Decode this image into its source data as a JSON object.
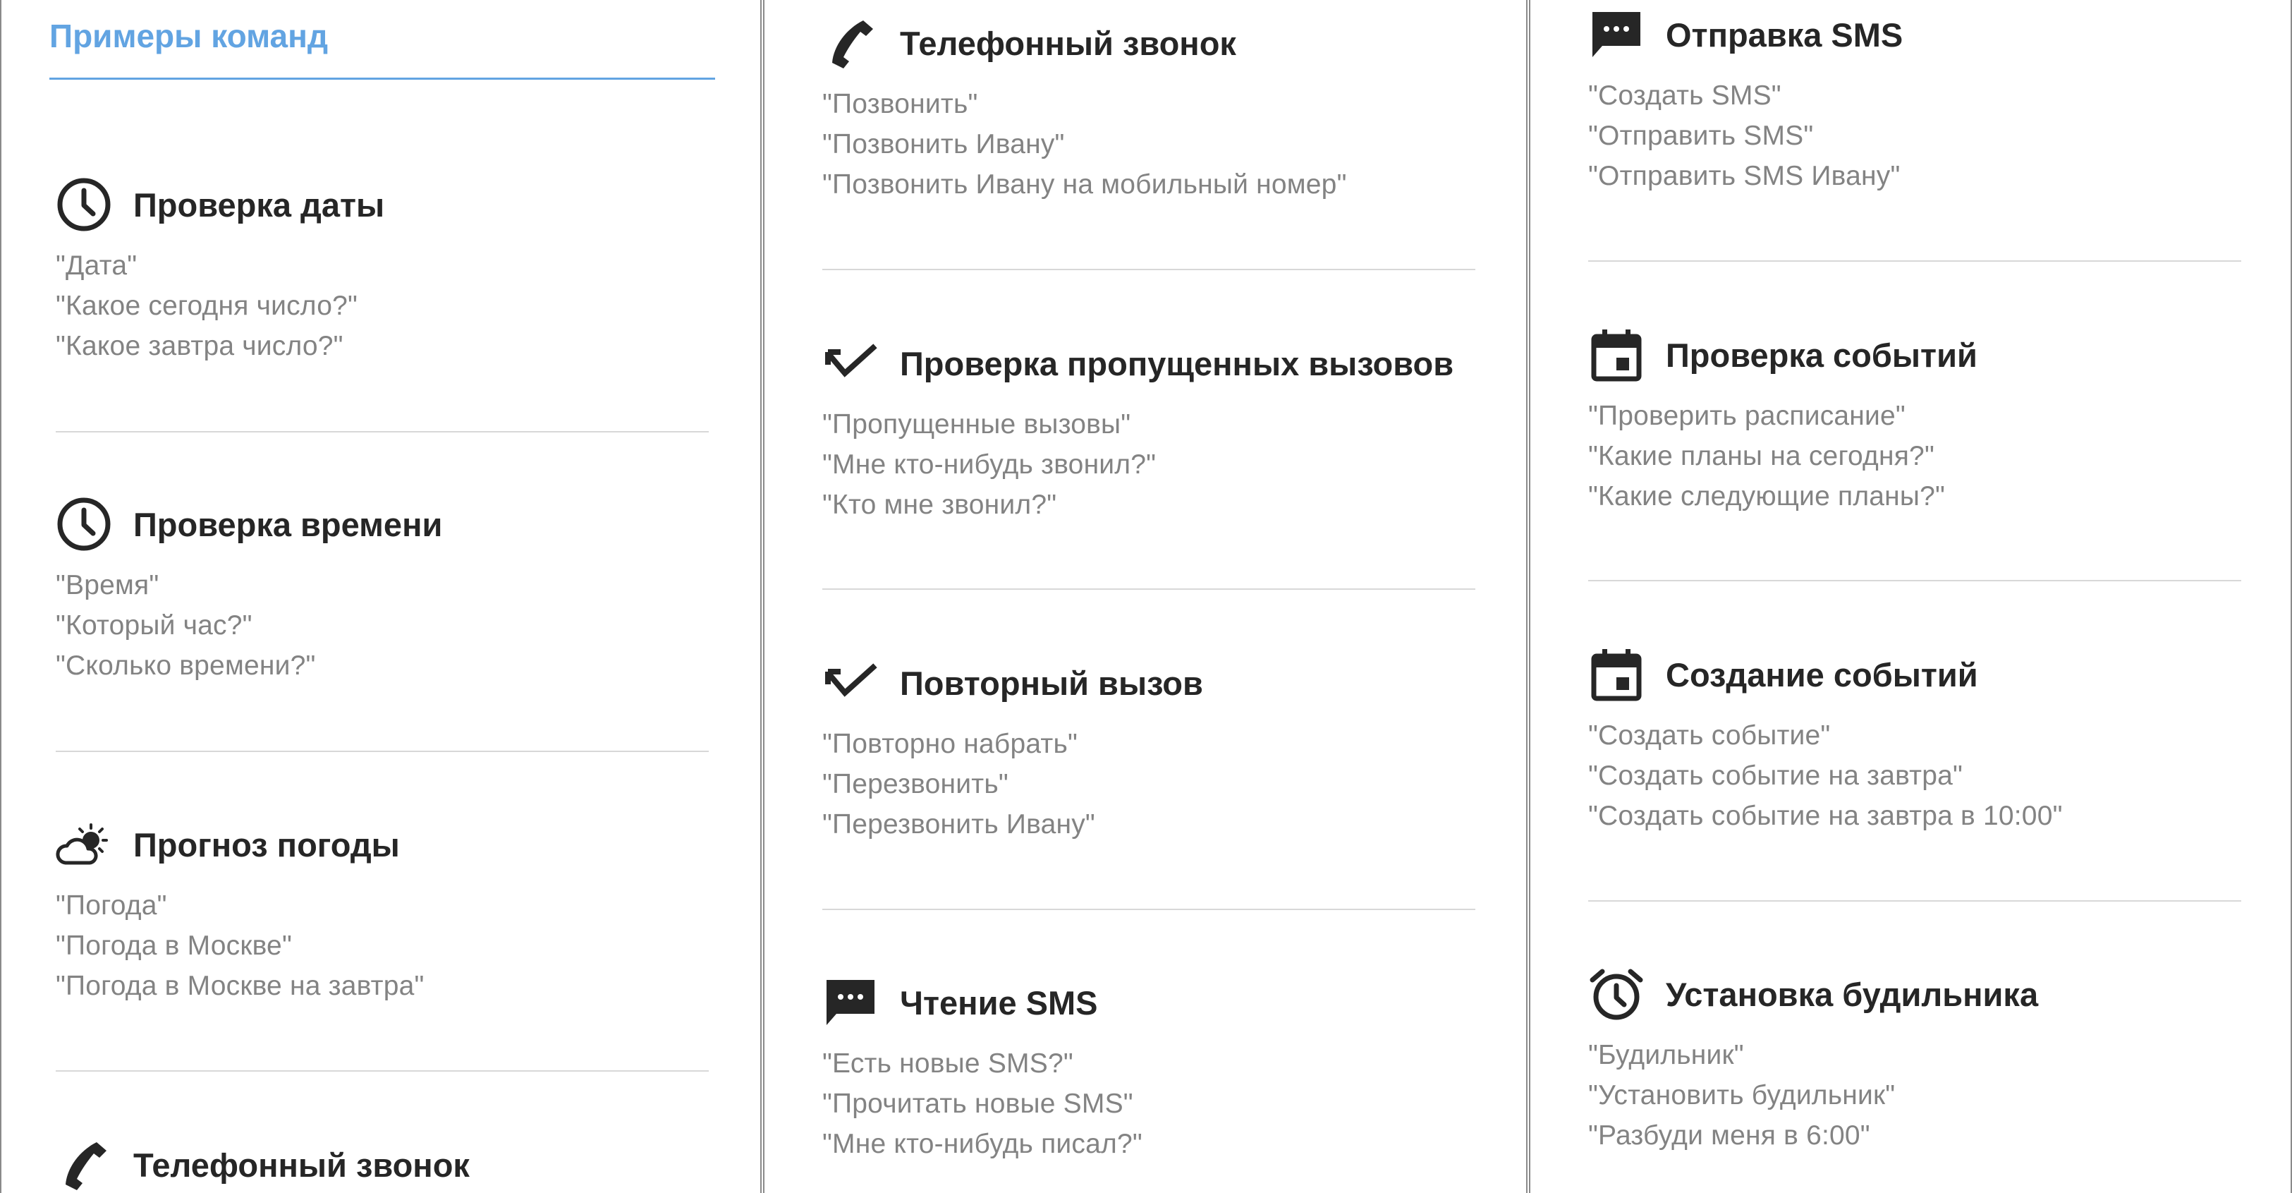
{
  "header": {
    "title": "Примеры команд"
  },
  "columns": [
    {
      "sections": [
        {
          "icon": "clock-icon",
          "title": "Проверка даты",
          "examples": [
            "\"Дата\"",
            "\"Какое сегодня число?\"",
            "\"Какое завтра число?\""
          ]
        },
        {
          "icon": "clock-icon",
          "title": "Проверка времени",
          "examples": [
            "\"Время\"",
            "\"Который час?\"",
            "\"Сколько времени?\""
          ]
        },
        {
          "icon": "weather-icon",
          "title": "Прогноз погоды",
          "examples": [
            "\"Погода\"",
            "\"Погода в Москве\"",
            "\"Погода в Москве на завтра\""
          ]
        },
        {
          "icon": "phone-icon",
          "title": "Телефонный звонок",
          "examples": []
        }
      ]
    },
    {
      "sections": [
        {
          "icon": "phone-icon",
          "title": "Телефонный звонок",
          "examples": [
            "\"Позвонить\"",
            "\"Позвонить Ивану\"",
            "\"Позвонить Ивану на мобильный номер\""
          ]
        },
        {
          "icon": "missed-call-icon",
          "title": "Проверка пропущенных вызовов",
          "examples": [
            "\"Пропущенные вызовы\"",
            "\"Мне кто-нибудь звонил?\"",
            "\"Кто мне звонил?\""
          ]
        },
        {
          "icon": "missed-call-icon",
          "title": "Повторный вызов",
          "examples": [
            "\"Повторно набрать\"",
            "\"Перезвонить\"",
            "\"Перезвонить Ивану\""
          ]
        },
        {
          "icon": "sms-icon",
          "title": "Чтение SMS",
          "examples": [
            "\"Есть новые SMS?\"",
            "\"Прочитать новые SMS\"",
            "\"Мне кто-нибудь писал?\""
          ]
        }
      ]
    },
    {
      "sections": [
        {
          "icon": "sms-icon",
          "title": "Отправка SMS",
          "examples": [
            "\"Создать SMS\"",
            "\"Отправить SMS\"",
            "\"Отправить SMS Ивану\""
          ]
        },
        {
          "icon": "calendar-icon",
          "title": "Проверка событий",
          "examples": [
            "\"Проверить расписание\"",
            "\"Какие планы на сегодня?\"",
            "\"Какие следующие планы?\""
          ]
        },
        {
          "icon": "calendar-icon",
          "title": "Создание событий",
          "examples": [
            "\"Создать событие\"",
            "\"Создать событие на завтра\"",
            "\"Создать событие на завтра в 10:00\""
          ]
        },
        {
          "icon": "alarm-icon",
          "title": "Установка будильника",
          "examples": [
            "\"Будильник\"",
            "\"Установить будильник\"",
            "\"Разбуди меня в 6:00\""
          ]
        }
      ]
    }
  ],
  "colors": {
    "accent": "#62a4e2",
    "heading": "#262626",
    "example_text": "#838383",
    "divider": "#d8d8d8"
  }
}
